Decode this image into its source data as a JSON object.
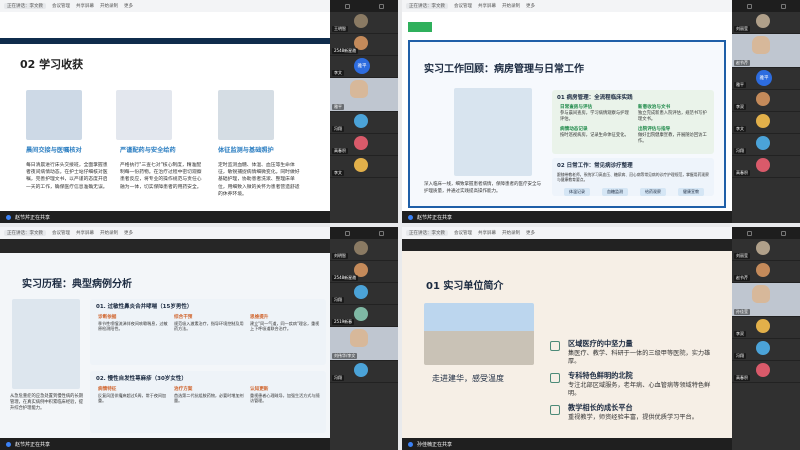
{
  "colors": {
    "accent": "#2d6cdf",
    "slide_blue": "#2d7fc2",
    "green": "#2fb05c",
    "dark": "#1b2a40"
  },
  "topbar": {
    "tab1": "正在讲话：李文教",
    "tab2": "会议管理",
    "tab3": "共享屏幕",
    "tab4": "开始录制",
    "tab5": "更多"
  },
  "q1": {
    "slide_title": "02 学习收获",
    "captions": [
      "晨间交接与医嘱核对",
      "严谨配药与安全给药",
      "体征监测与基础照护"
    ],
    "texts": [
      "每日清晨进行床头交接班，全面掌握患者夜间病情动态。在护士站仔细核对医嘱，完善护理文书，以严谨的态度开启一天的工作，确保医疗信息准确无误。",
      "严格执行\"三查七对\"核心制度，精准配制每一份药物。在治疗过程中密切观察患者反应，将专业的操作规范与责任心融为一体，切实保障患者的用药安全。",
      "定时监测血糖、体温、血压等生命体征，敏锐捕捉病情细微变化。同时做好基础护理，协助患者洗漱、整理床单位，用细致入微的关怀为患者营造舒适的休养环境。"
    ],
    "share": "赵节芹正在共享",
    "participants": [
      "王明智",
      "2548新星邀",
      "李文",
      "雅平",
      "冯翔",
      "高春积",
      "李文"
    ],
    "avatar_text": "雅平"
  },
  "q2": {
    "slide_title": "实习工作回顾：病房管理与日常工作",
    "caption": "深入临床一线，细致掌握患者病情，保障患者的医疗安全与护理质量，并通过实践提高操作能力。",
    "card1_title": "01 病房管理：全流程临床实践",
    "card2_title": "02 日常工作：常见病诊疗整理",
    "minis": [
      {
        "h": "日常查房与评估",
        "d": "参与晨间查房，学习病情观察与护理评估。"
      },
      {
        "h": "新患收治与文书",
        "d": "独立完成新患入院评估，规范书写护理文书。"
      },
      {
        "h": "病情动态记录",
        "d": "按时巡视病房，记录生命体征变化。"
      },
      {
        "h": "出院评估与指导",
        "d": "做好出院健康宣教，开展随访回访工作。"
      }
    ],
    "card2_text": "跟随带教老师，系统学习高血压、糖尿病、冠心病等常见病的诊疗护理规范，掌握用药观察与健康教育要点。",
    "chips": [
      "体温记录",
      "血糖监测",
      "给药观察",
      "健康宣教"
    ],
    "share": "赵节芹正在共享",
    "participants": [
      "刘丽莹",
      "赵节芹",
      "雅平",
      "李双",
      "李文",
      "冯翔",
      "高春积"
    ],
    "avatar_text": "雅平"
  },
  "q3": {
    "slide_title": "实习历程：典型病例分析",
    "caption": "从急危重症的应急处置到慢性病的长期管理，在真实病例中积累临床经验，提升综合护理能力。",
    "case1_title": "01. 过敏性鼻炎合并哮喘（15岁男性）",
    "case2_title": "02. 慢性自发性荨麻疹（30岁女性）",
    "case1": [
      {
        "h": "诊断依据",
        "d": "季节性喷嚏流涕伴夜间咳嗽喘息，过敏原检测阳性。"
      },
      {
        "h": "综合干预",
        "d": "规范吸入激素治疗，指导环境控制及用药方法。"
      },
      {
        "h": "思维提升",
        "d": "建立\"同一气道，同一疾病\"理念，重视上下呼吸道联合治疗。"
      }
    ],
    "case2": [
      {
        "h": "病情特征",
        "d": "反复风团伴瘙痒超过6周，常于夜间加重。"
      },
      {
        "h": "治疗方案",
        "d": "首选第二代抗组胺药物，必要时增加剂量。"
      },
      {
        "h": "认知更新",
        "d": "重视患者心理疏导，加强生活方式与随访管理。"
      }
    ],
    "share": "赵节芹正在共享",
    "participants": [
      "刘明智",
      "2548新星邀",
      "冯翔",
      "2519新春",
      "刘伟华/李文",
      "冯翔"
    ]
  },
  "q4": {
    "slide_title": "01 实习单位简介",
    "slogan": "走进建华，感受温度",
    "points": [
      {
        "h": "区域医疗的中坚力量",
        "d": "集医疗、教学、科研于一体的三级甲等医院，实力雄厚。"
      },
      {
        "h": "专科特色鲜明的北院",
        "d": "专注北部区域服务，老年病、心血管病等领域特色鲜明。"
      },
      {
        "h": "教学相长的成长平台",
        "d": "重视教学，师资经验丰富，提供优质学习平台。"
      }
    ],
    "share": "孙佳楠正在共享",
    "participants": [
      "刘丽莹",
      "赵节芹",
      "孙佳莹",
      "李双",
      "冯翔",
      "高春积"
    ]
  }
}
